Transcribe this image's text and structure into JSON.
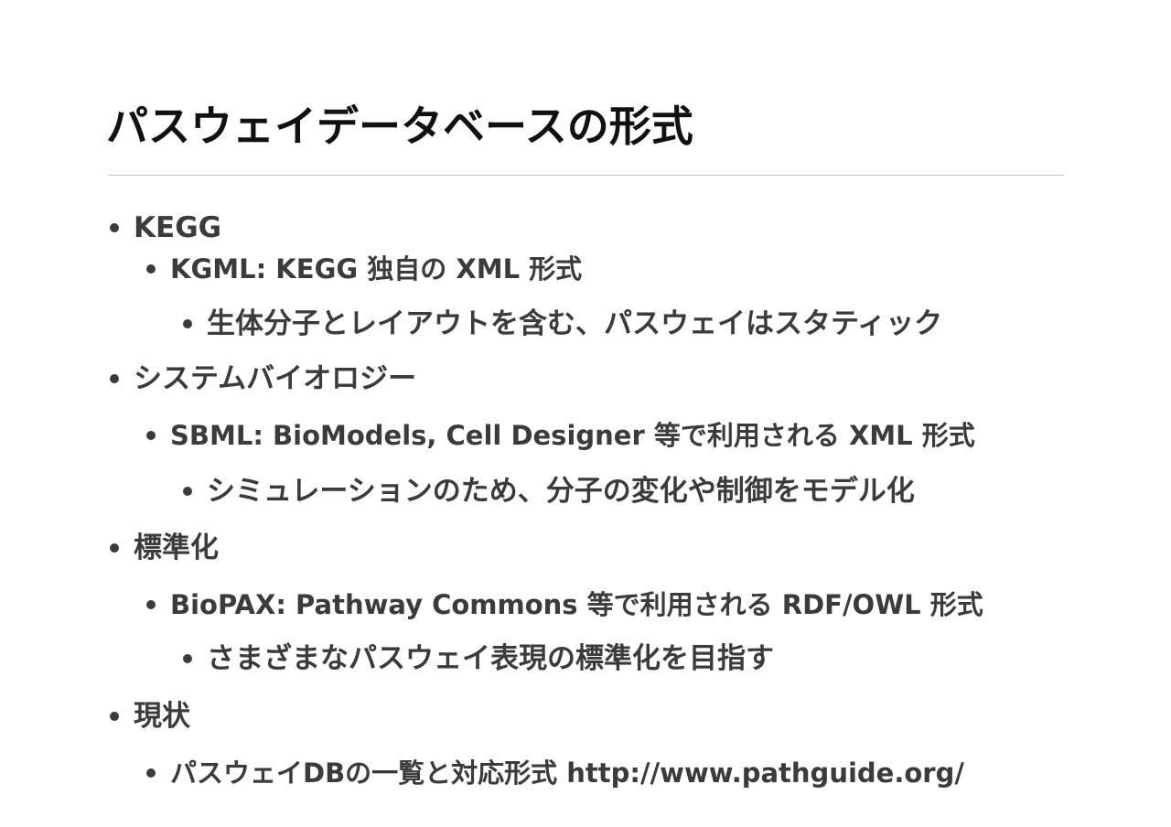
{
  "slide": {
    "title": "パスウェイデータベースの形式",
    "items": [
      {
        "level": 1,
        "text": "KEGG"
      },
      {
        "level": 2,
        "text": "KGML: KEGG 独自の XML 形式"
      },
      {
        "level": 3,
        "text": "生体分子とレイアウトを含む、パスウェイはスタティック"
      },
      {
        "level": 1,
        "text": "システムバイオロジー"
      },
      {
        "level": 2,
        "text": "SBML: BioModels, Cell Designer 等で利用される XML 形式"
      },
      {
        "level": 3,
        "text": "シミュレーションのため、分子の変化や制御をモデル化"
      },
      {
        "level": 1,
        "text": "標準化"
      },
      {
        "level": 2,
        "text": "BioPAX: Pathway Commons 等で利用される RDF/OWL 形式"
      },
      {
        "level": 3,
        "text": "さまざまなパスウェイ表現の標準化を目指す"
      },
      {
        "level": 1,
        "text": "現状"
      },
      {
        "level": 2,
        "text": "パスウェイDBの一覧と対応形式 http://www.pathguide.org/"
      }
    ]
  }
}
